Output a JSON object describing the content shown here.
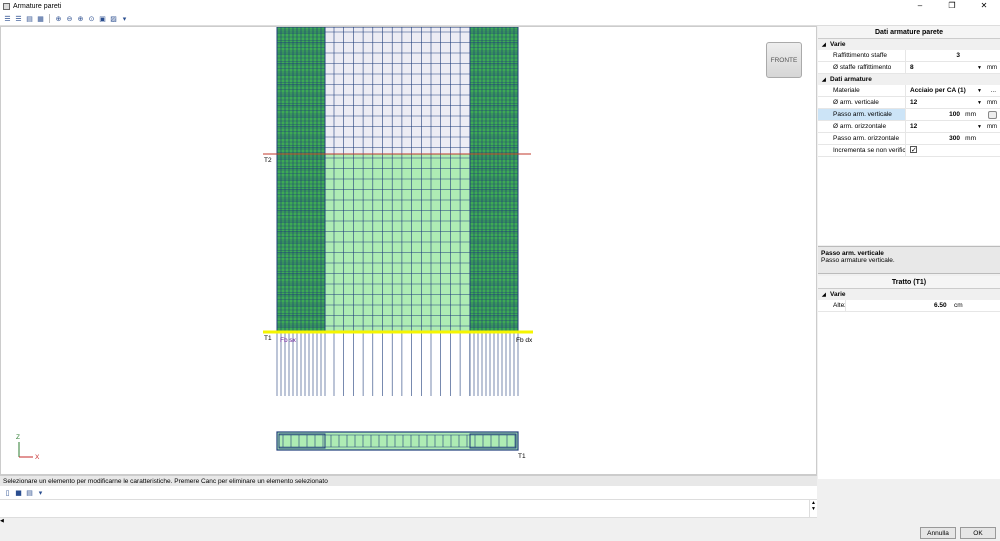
{
  "window": {
    "title": "Armature pareti"
  },
  "canvas": {
    "view_button": "FRONTE",
    "labels": {
      "t2": "T2",
      "t1": "T1",
      "fb_sx": "Fb sx",
      "fb_dx": "Fb dx",
      "t1_section": "T1"
    },
    "axes": {
      "z": "Z",
      "x": "X"
    }
  },
  "status": {
    "text": "Selezionare un elemento per modificarne le caratteristiche. Premere Canc per eliminare un elemento selezionato"
  },
  "panel": {
    "title": "Dati armature parete",
    "varie": {
      "header": "Varie",
      "raffittimento_staffe": {
        "label": "Raffittimento staffe",
        "value": "3"
      },
      "staffe_raffittimento": {
        "label": "Ø staffe raffittimento",
        "value": "8",
        "unit": "mm"
      }
    },
    "dati_armature": {
      "header": "Dati armature",
      "materiale": {
        "label": "Materiale",
        "value": "Acciaio per CA (1)",
        "extra": "..."
      },
      "arm_verticale": {
        "label": "Ø arm. verticale",
        "value": "12",
        "unit": "mm"
      },
      "passo_verticale": {
        "label": "Passo arm. verticale",
        "value": "100",
        "unit": "mm"
      },
      "arm_orizzontale": {
        "label": "Ø arm. orizzontale",
        "value": "12",
        "unit": "mm"
      },
      "passo_orizzontale": {
        "label": "Passo arm. orizzontale",
        "value": "300",
        "unit": "mm"
      },
      "incrementa": {
        "label": "Incrementa se non verifica",
        "checked": true
      }
    },
    "description": {
      "title": "Passo arm. verticale",
      "text": "Passo armature verticale."
    },
    "tratto": {
      "title": "Tratto (T1)",
      "varie": {
        "header": "Varie",
        "altezza": {
          "label": "Altezza",
          "value": "6.50",
          "unit": "cm"
        }
      }
    }
  },
  "buttons": {
    "annulla": "Annulla",
    "ok": "OK"
  },
  "colors": {
    "green_dark": "#3daa55",
    "green_light": "#aeecb4",
    "grid": "#1f3d7a",
    "highlight": "#f5f500",
    "red_line": "#c0392b"
  }
}
